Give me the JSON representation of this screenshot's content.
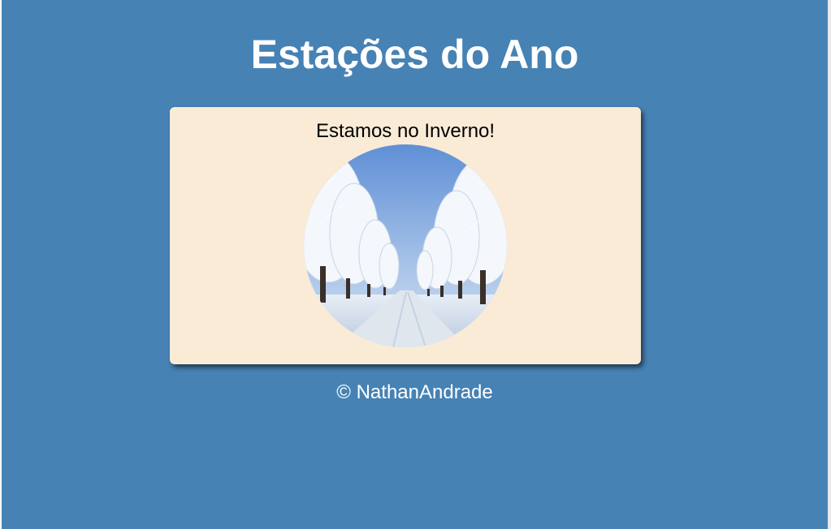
{
  "header": {
    "title": "Estações do Ano"
  },
  "season_card": {
    "message": "Estamos no Inverno!",
    "image_icon": "winter-snowy-tree-avenue"
  },
  "footer": {
    "copyright": "© NathanAndrade"
  },
  "colors": {
    "page_background": "#4682b4",
    "card_background": "#faebd7",
    "title_text": "#ffffff",
    "message_text": "#000000"
  }
}
